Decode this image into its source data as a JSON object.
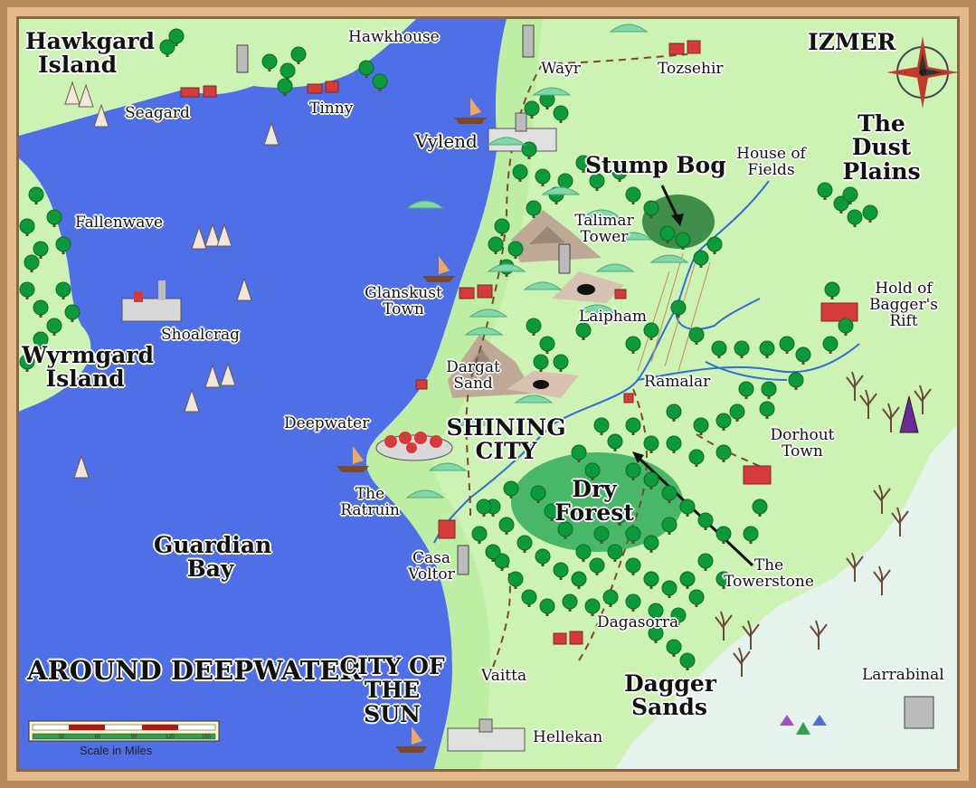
{
  "map": {
    "title": "AROUND DEEPWATER",
    "scale": {
      "caption": "Scale in Miles",
      "ticks": [
        "30",
        "60",
        "90",
        "120",
        "150"
      ]
    },
    "regions": {
      "izmer": "IZMER",
      "dust_plains": "The Dust Plains",
      "guardian_bay": "Guardian Bay",
      "hawkgard_island": "Hawkgard Island",
      "wyrmgard_island": "Wyrmgard Island",
      "stump_bog": "Stump Bog",
      "dry_forest": "Dry Forest",
      "dagger_sands": "Dagger Sands",
      "shining_city": "SHINING CITY",
      "city_of_the_sun": "CITY OF THE SUN"
    },
    "places": {
      "hawkhouse": "Hawkhouse",
      "seagard": "Seagard",
      "tinny": "Tinny",
      "wayr": "Wayr",
      "tozsehir": "Tozsehir",
      "vylend": "Vylend",
      "house_of_fields": "House of Fields",
      "fallenwave": "Fallenwave",
      "talimar_tower": "Talimar Tower",
      "glanskust_town": "Glanskust Town",
      "laipham": "Laipham",
      "hold_of_baggers_rift": "Hold of Bagger's Rift",
      "shoalcrag": "Shoalcrag",
      "dargat_sand": "Dargat Sand",
      "ramalar": "Ramalar",
      "deepwater": "Deepwater",
      "dorhout_town": "Dorhout Town",
      "the_ratruin": "The Ratruin",
      "casa_voltor": "Casa Voltor",
      "the_towerstone": "The Towerstone",
      "dagasorra": "Dagasorra",
      "vaitta": "Vaitta",
      "hellekan": "Hellekan",
      "larrabinal": "Larrabinal"
    },
    "colors": {
      "frame": "#b98a5e",
      "water": "#4f6fe6",
      "land": "#cdf3b4",
      "coast_land": "#bdeea3",
      "desert": "#e6f3ec",
      "forest": "#0d9a3a",
      "bog": "#3f8f4a",
      "mountain": "#bda996",
      "river": "#2f6cd4"
    }
  }
}
